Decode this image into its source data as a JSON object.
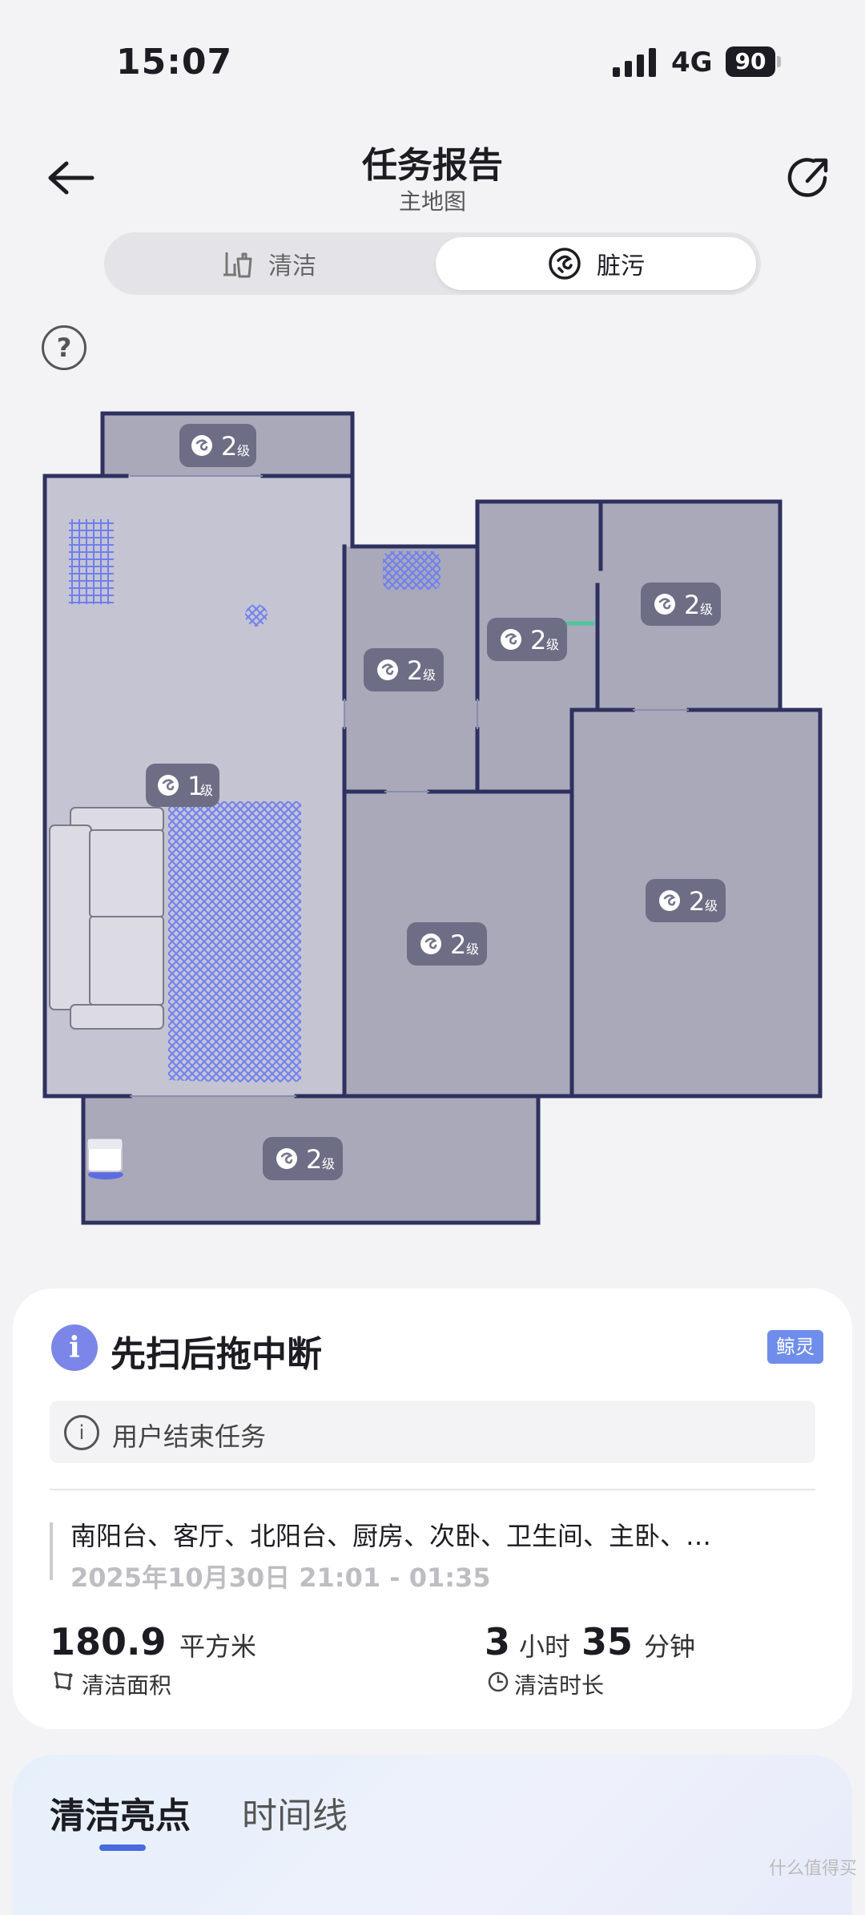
{
  "status_bar": {
    "time": "15:07",
    "network": "4G",
    "battery": "90"
  },
  "header": {
    "title": "任务报告",
    "subtitle": "主地图"
  },
  "segments": {
    "clean_label": "清洁",
    "dirty_label": "脏污",
    "active": "dirty"
  },
  "help_icon": "?",
  "map": {
    "level_unit": "级",
    "rooms": [
      {
        "id": "south-balcony-top",
        "level": "2"
      },
      {
        "id": "living-room",
        "level": "1"
      },
      {
        "id": "kitchen",
        "level": "2"
      },
      {
        "id": "bathroom",
        "level": "2"
      },
      {
        "id": "bedroom-ne",
        "level": "2"
      },
      {
        "id": "room-center",
        "level": "2"
      },
      {
        "id": "master-bedroom",
        "level": "2"
      },
      {
        "id": "balcony-bottom",
        "level": "2"
      }
    ]
  },
  "report": {
    "status_title": "先扫后拖中断",
    "badge": "鲸灵",
    "reason": "用户结束任务",
    "rooms_text": "南阳台、客厅、北阳台、厨房、次卧、卫生间、主卧、…",
    "datetime": "2025年10月30日 21:01 - 01:35",
    "area_value": "180.9",
    "area_unit": "平方米",
    "area_label": "清洁面积",
    "duration_hours": "3",
    "hours_unit": "小时",
    "duration_minutes": "35",
    "minutes_unit": "分钟",
    "duration_label": "清洁时长"
  },
  "tabs": {
    "highlights": "清洁亮点",
    "timeline": "时间线"
  },
  "watermark": "什么值得买",
  "colors": {
    "wall": "#2e3160",
    "room_fill": "#a9a9ba",
    "living_fill": "#c4c4d2",
    "dirt": "#6f7ff0",
    "accent": "#4a6ae0"
  }
}
